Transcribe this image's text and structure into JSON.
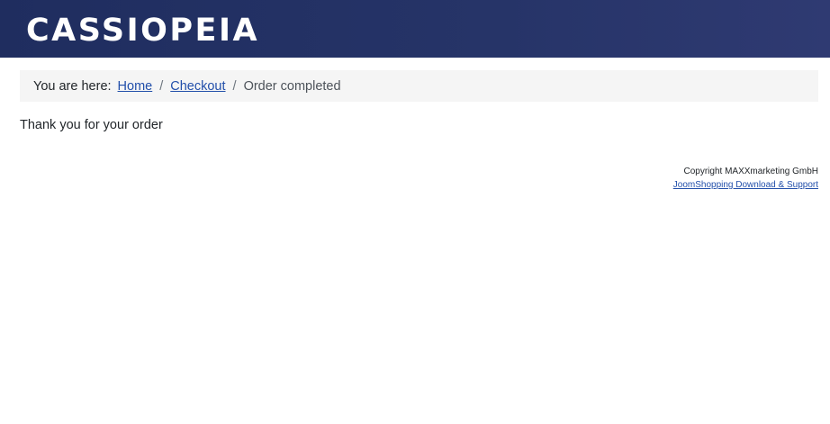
{
  "header": {
    "brand": "CASSIOPEIA"
  },
  "breadcrumb": {
    "prefix": "You are here:",
    "items": [
      {
        "label": "Home"
      },
      {
        "label": "Checkout"
      }
    ],
    "separator": "/",
    "current": "Order completed"
  },
  "main": {
    "message": "Thank you for your order"
  },
  "footer": {
    "copyright": "Copyright MAXXmarketing GmbH",
    "link_label": "JoomShopping Download & Support"
  },
  "colors": {
    "header_bg": "#263468",
    "link": "#224faa",
    "breadcrumb_bg": "#f5f5f5"
  }
}
